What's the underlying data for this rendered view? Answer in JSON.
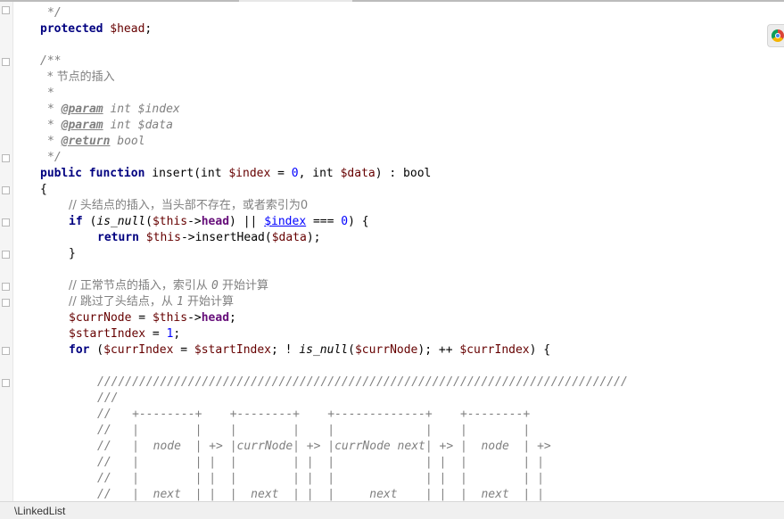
{
  "editor": {
    "lines": {
      "l1": "*/",
      "l2_kw": "protected",
      "l2_var": "$head",
      "l2_end": ";",
      "l4": "/**",
      "l5": "* 节点的插入",
      "l6": "*",
      "l7_pre": "* ",
      "l7_tag": "@param",
      "l7_rest": " int $index",
      "l8_pre": "* ",
      "l8_tag": "@param",
      "l8_rest": " int $data",
      "l9_pre": "* ",
      "l9_tag": "@return",
      "l9_rest": " bool",
      "l10": "*/",
      "l11_kw1": "public",
      "l11_kw2": "function",
      "l11_a": " insert(int ",
      "l11_var1": "$index",
      "l11_b": " = ",
      "l11_num1": "0",
      "l11_c": ", int ",
      "l11_var2": "$data",
      "l11_d": ") : bool",
      "l12": "{",
      "l13": "// 头结点的插入，当头部不存在，或者索引为0",
      "l14_kw": "if",
      "l14_a": " (",
      "l14_fn": "is_null",
      "l14_b": "(",
      "l14_var1": "$this",
      "l14_c": "->",
      "l14_fld": "head",
      "l14_d": ") || ",
      "l14_link": "$index",
      "l14_e": " === ",
      "l14_num": "0",
      "l14_f": ") {",
      "l15_kw": "return",
      "l15_var1": "$this",
      "l15_a": "->insertHead(",
      "l15_var2": "$data",
      "l15_b": ");",
      "l16": "}",
      "l18_a": "// 正常节点的插入，索引从 ",
      "l18_num": "0",
      "l18_b": " 开始计算",
      "l19_a": "// 跳过了头结点，从 ",
      "l19_num": "1",
      "l19_b": " 开始计算",
      "l20_var1": "$currNode",
      "l20_a": " = ",
      "l20_var2": "$this",
      "l20_b": "->",
      "l20_fld": "head",
      "l20_c": ";",
      "l21_var": "$startIndex",
      "l21_a": " = ",
      "l21_num": "1",
      "l21_b": ";",
      "l22_kw": "for",
      "l22_a": " (",
      "l22_var1": "$currIndex",
      "l22_b": " = ",
      "l22_var2": "$startIndex",
      "l22_c": "; ! ",
      "l22_fn": "is_null",
      "l22_d": "(",
      "l22_var3": "$currNode",
      "l22_e": "); ++ ",
      "l22_var4": "$currIndex",
      "l22_f": ") {",
      "l24": "////////////////////////////////////////////////////////////////////////////",
      "l25": "///",
      "l26": "//   +--------+    +--------+    +-------------+    +--------+",
      "l27": "//   |        |    |        |    |             |    |        |",
      "l28": "//   |  node  | +> |currNode| +> |currNode next| +> |  node  | +>",
      "l29": "//   |        | |  |        | |  |             | |  |        | |",
      "l30": "//   |        | |  |        | |  |             | |  |        | |",
      "l31": "//   |  next  | |  |  next  | |  |     next    | |  |  next  | |"
    }
  },
  "statusbar": {
    "path": "\\LinkedList"
  },
  "icons": {
    "chrome": "chrome-icon"
  }
}
